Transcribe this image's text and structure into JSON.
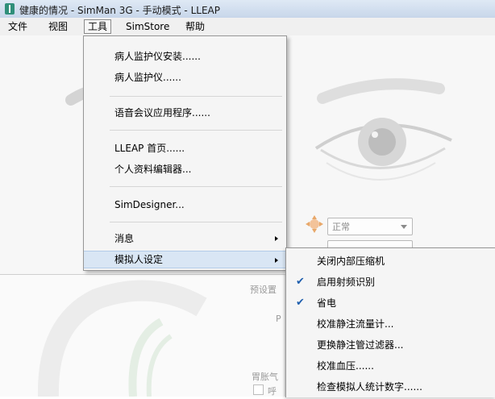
{
  "window": {
    "title": "健康的情况 - SimMan 3G - 手动模式 - LLEAP"
  },
  "menubar": {
    "items": [
      {
        "label": "文件"
      },
      {
        "label": "视图"
      },
      {
        "label": "工具"
      },
      {
        "label": "SimStore"
      },
      {
        "label": "帮助"
      }
    ],
    "active": "工具"
  },
  "tools_menu": {
    "items": [
      {
        "label": "病人监护仪安装......"
      },
      {
        "label": "病人监护仪......"
      },
      {
        "label": "语音会议应用程序......"
      },
      {
        "label": "LLEAP 首页......"
      },
      {
        "label": "个人资料编辑器..."
      },
      {
        "label": "SimDesigner..."
      },
      {
        "label": "消息",
        "has_submenu": true
      },
      {
        "label": "模拟人设定",
        "has_submenu": true,
        "highlighted": true
      }
    ]
  },
  "simulator_settings_submenu": {
    "items": [
      {
        "label": "关闭内部压缩机",
        "checked": false
      },
      {
        "label": "启用射频识别",
        "checked": true
      },
      {
        "label": "省电",
        "checked": true
      },
      {
        "label": "校准静注流量计...",
        "checked": false
      },
      {
        "label": "更换静注管过滤器...",
        "checked": false
      },
      {
        "label": "校准血压......",
        "checked": false
      },
      {
        "label": "检查模拟人统计数字......",
        "checked": false
      }
    ]
  },
  "background": {
    "pupil_combo_value": "正常",
    "preset_label": "预设置",
    "stomach_label": "胃胀气",
    "breath_label": "呼"
  },
  "colors": {
    "menu_highlight": "#d9e6f4",
    "check_mark": "#1f5fae",
    "titlebar": "#c7d6ea"
  }
}
